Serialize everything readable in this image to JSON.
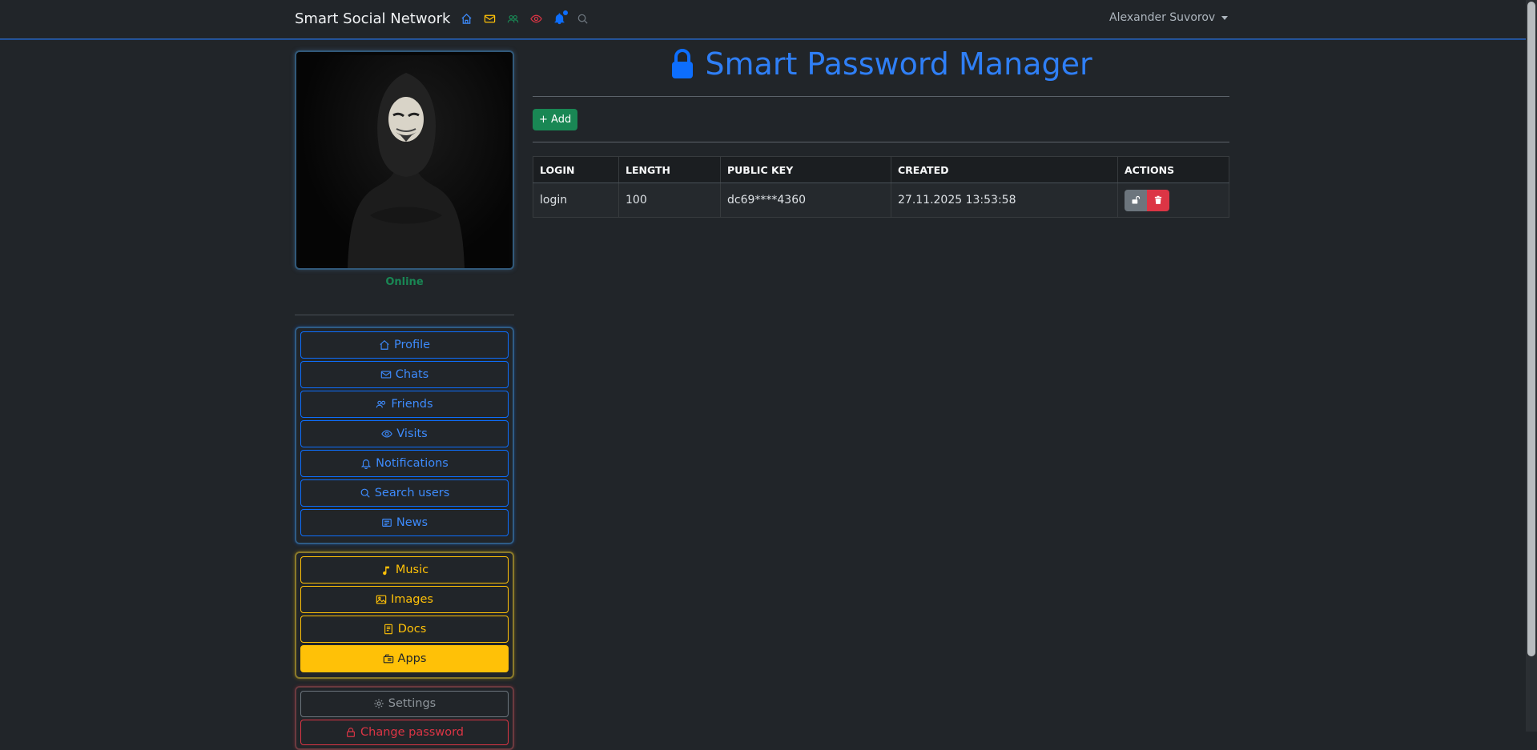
{
  "navbar": {
    "brand": "Smart Social Network",
    "icons": [
      "home-icon",
      "envelope-icon",
      "people-icon",
      "eye-icon",
      "bell-icon",
      "search-icon"
    ],
    "user_name": "Alexander Suvorov"
  },
  "sidebar": {
    "status": "Online",
    "nav_items": [
      {
        "label": "Profile",
        "icon": "home-icon"
      },
      {
        "label": "Chats",
        "icon": "envelope-icon"
      },
      {
        "label": "Friends",
        "icon": "people-icon"
      },
      {
        "label": "Visits",
        "icon": "eye-icon"
      },
      {
        "label": "Notifications",
        "icon": "bell-icon"
      },
      {
        "label": "Search users",
        "icon": "search-icon"
      },
      {
        "label": "News",
        "icon": "newspaper-icon"
      }
    ],
    "media_items": [
      {
        "label": "Music",
        "icon": "music-note-icon"
      },
      {
        "label": "Images",
        "icon": "image-icon"
      },
      {
        "label": "Docs",
        "icon": "document-icon"
      },
      {
        "label": "Apps",
        "icon": "apps-icon",
        "active": true
      }
    ],
    "account_items": [
      {
        "label": "Settings",
        "icon": "gear-icon"
      },
      {
        "label": "Change password",
        "icon": "lock-icon"
      }
    ]
  },
  "main": {
    "title": "Smart Password Manager",
    "add_label": "+ Add",
    "table": {
      "headers": [
        "LOGIN",
        "LENGTH",
        "PUBLIC KEY",
        "CREATED",
        "ACTIONS"
      ],
      "rows": [
        [
          "login",
          "100",
          "dc69****4360",
          "27.11.2025 13:53:58"
        ]
      ]
    }
  },
  "colors": {
    "background": "#212529",
    "primary": "#0d6efd",
    "warning": "#ffc107",
    "success": "#198754",
    "danger": "#dc3545",
    "secondary": "#6c757d"
  }
}
